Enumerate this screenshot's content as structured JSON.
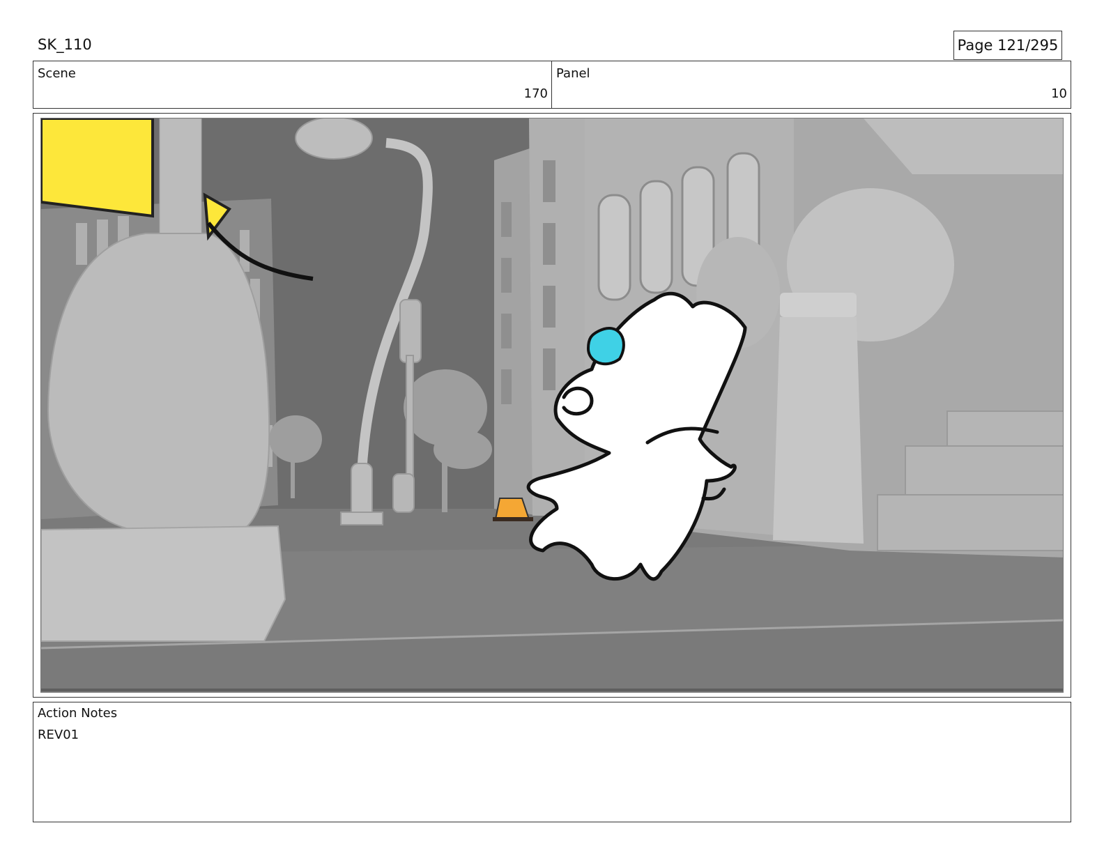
{
  "header": {
    "doc_title": "SK_110",
    "page_label": "Page 121/295"
  },
  "fields": {
    "scene_label": "Scene",
    "scene_value": "170",
    "panel_label": "Panel",
    "panel_value": "10"
  },
  "notes": {
    "label": "Action Notes",
    "text": "REV01"
  },
  "colors": {
    "sign_yellow": "#fde73a",
    "cone_orange": "#f5a734",
    "eye_cyan": "#3fd1e6",
    "sky_gray": "#6f6f6f",
    "geometry_gray": "#bdbdbd"
  }
}
